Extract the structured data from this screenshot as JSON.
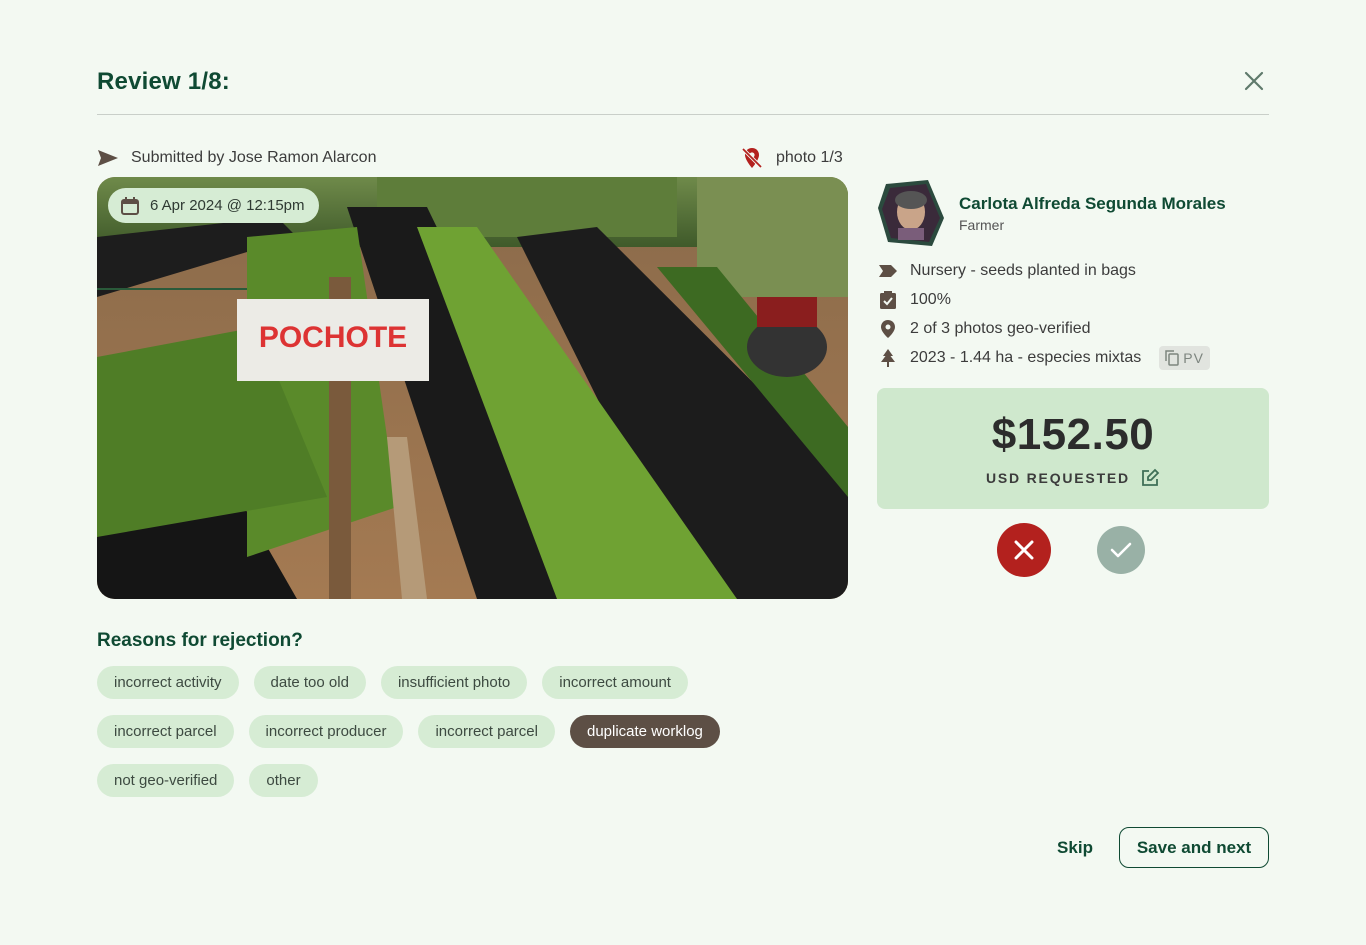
{
  "header": {
    "title": "Review 1/8:"
  },
  "submission": {
    "submitted_by": "Submitted by Jose Ramon Alarcon",
    "photo_counter": "photo 1/3"
  },
  "photo": {
    "date": "6 Apr 2024 @ 12:15pm",
    "sign_text": "POCHOTE"
  },
  "profile": {
    "name": "Carlota Alfreda Segunda Morales",
    "role": "Farmer"
  },
  "details": {
    "activity": "Nursery - seeds planted in bags",
    "completion": "100%",
    "geo": "2 of 3 photos geo-verified",
    "parcel": "2023 - 1.44 ha - especies mixtas",
    "parcel_code": "PV"
  },
  "amount": {
    "value": "$152.50",
    "label": "USD REQUESTED"
  },
  "reasons": {
    "title": "Reasons for rejection?",
    "rows": [
      [
        "incorrect activity",
        "date too old",
        "insufficient photo",
        "incorrect amount"
      ],
      [
        "incorrect parcel",
        "incorrect producer",
        "incorrect parcel",
        "duplicate worklog"
      ],
      [
        "not geo-verified",
        "other"
      ]
    ],
    "selected": "duplicate worklog"
  },
  "footer": {
    "skip": "Skip",
    "save": "Save and next"
  },
  "colors": {
    "brand": "#0f4a33",
    "reject": "#b3211e",
    "approve": "#99b1a6",
    "chip": "#d6ecd4",
    "chip_selected": "#5d4f45"
  }
}
